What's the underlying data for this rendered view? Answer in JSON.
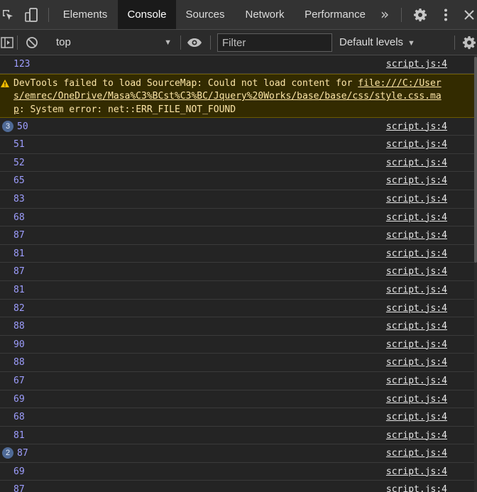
{
  "tabs": [
    {
      "label": "Elements",
      "active": false
    },
    {
      "label": "Console",
      "active": true
    },
    {
      "label": "Sources",
      "active": false
    },
    {
      "label": "Network",
      "active": false
    },
    {
      "label": "Performance",
      "active": false
    }
  ],
  "toolbar": {
    "context": "top",
    "filter_placeholder": "Filter",
    "levels_label": "Default levels"
  },
  "warning": {
    "prefix": "DevTools failed to load SourceMap: Could not load content for ",
    "link": "file:///C:/Users/emrec/OneDrive/Masa%C3%BCst%C3%BC/Jquery%20Works/base/base/css/style.css.map",
    "suffix": ": System error: net::ERR_FILE_NOT_FOUND"
  },
  "first_log": {
    "value": "123",
    "source": "script.js:4"
  },
  "logs": [
    {
      "count": "3",
      "value": "50",
      "source": "script.js:4"
    },
    {
      "count": "",
      "value": "51",
      "source": "script.js:4"
    },
    {
      "count": "",
      "value": "52",
      "source": "script.js:4"
    },
    {
      "count": "",
      "value": "65",
      "source": "script.js:4"
    },
    {
      "count": "",
      "value": "83",
      "source": "script.js:4"
    },
    {
      "count": "",
      "value": "68",
      "source": "script.js:4"
    },
    {
      "count": "",
      "value": "87",
      "source": "script.js:4"
    },
    {
      "count": "",
      "value": "81",
      "source": "script.js:4"
    },
    {
      "count": "",
      "value": "87",
      "source": "script.js:4"
    },
    {
      "count": "",
      "value": "81",
      "source": "script.js:4"
    },
    {
      "count": "",
      "value": "82",
      "source": "script.js:4"
    },
    {
      "count": "",
      "value": "88",
      "source": "script.js:4"
    },
    {
      "count": "",
      "value": "90",
      "source": "script.js:4"
    },
    {
      "count": "",
      "value": "88",
      "source": "script.js:4"
    },
    {
      "count": "",
      "value": "67",
      "source": "script.js:4"
    },
    {
      "count": "",
      "value": "69",
      "source": "script.js:4"
    },
    {
      "count": "",
      "value": "68",
      "source": "script.js:4"
    },
    {
      "count": "",
      "value": "81",
      "source": "script.js:4"
    },
    {
      "count": "2",
      "value": "87",
      "source": "script.js:4"
    },
    {
      "count": "",
      "value": "69",
      "source": "script.js:4"
    },
    {
      "count": "",
      "value": "87",
      "source": "script.js:4"
    }
  ],
  "colors": {
    "background": "#242424",
    "log_value": "#9e9eff",
    "warning_bg": "#332b00",
    "warning_text": "#fce5a8",
    "badge": "#4f6a96"
  },
  "icons": [
    "inspect-element-icon",
    "device-toolbar-icon",
    "more-tabs-icon",
    "settings-gear-icon",
    "kebab-menu-icon",
    "close-icon",
    "sidebar-toggle-icon",
    "clear-console-icon",
    "live-expression-eye-icon",
    "console-settings-gear-icon",
    "warning-triangle-icon"
  ]
}
